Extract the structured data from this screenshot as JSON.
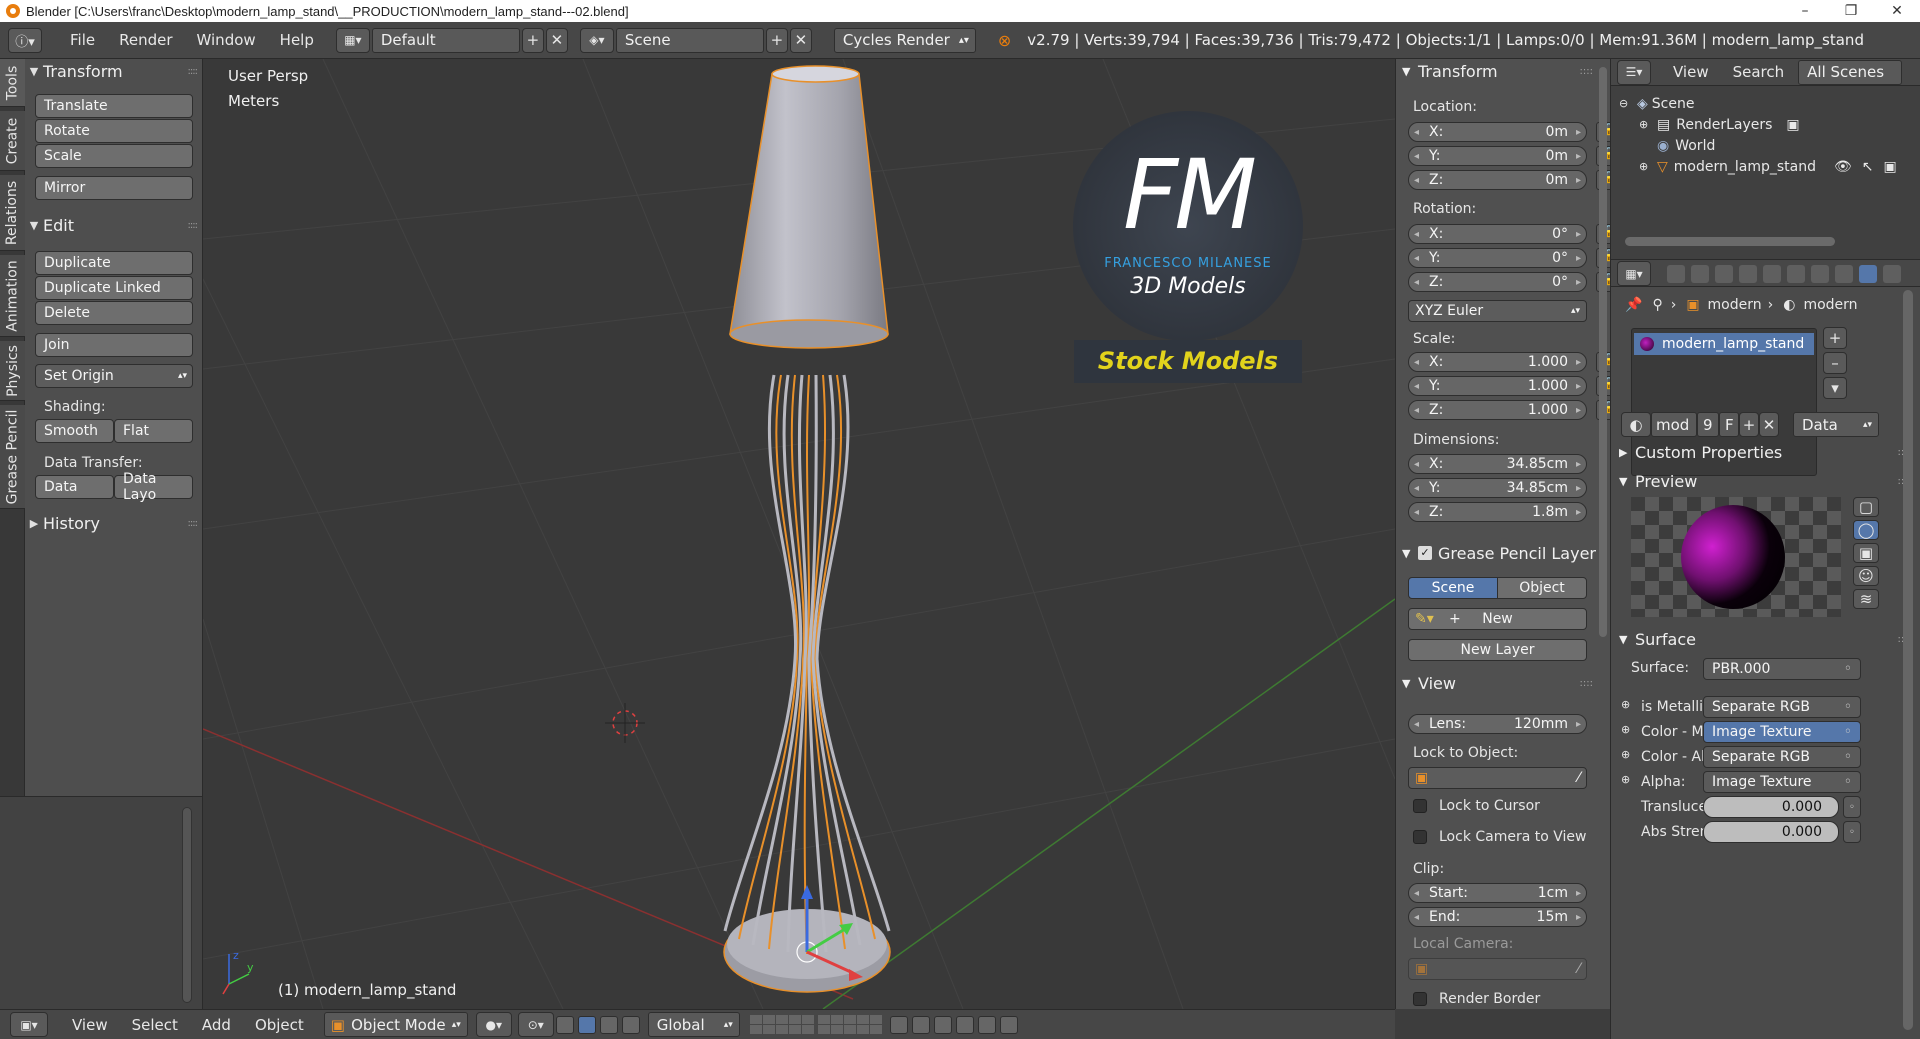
{
  "window": {
    "title": "Blender [C:\\Users\\franc\\Desktop\\modern_lamp_stand\\__PRODUCTION\\modern_lamp_stand---02.blend]",
    "minimize": "–",
    "maximize": "❐",
    "close": "✕"
  },
  "infobar": {
    "menus": [
      "File",
      "Render",
      "Window",
      "Help"
    ],
    "layout": "Default",
    "scene": "Scene",
    "engine": "Cycles Render",
    "stats": "v2.79 | Verts:39,794 | Faces:39,736 | Tris:79,472 | Objects:1/1 | Lamps:0/0 | Mem:91.36M | modern_lamp_stand"
  },
  "vtabs": [
    "Tools",
    "Create",
    "Relations",
    "Animation",
    "Physics",
    "Grease Pencil"
  ],
  "toolshelf": {
    "transform_title": "Transform",
    "translate": "Translate",
    "rotate": "Rotate",
    "scale": "Scale",
    "mirror": "Mirror",
    "edit_title": "Edit",
    "duplicate": "Duplicate",
    "duplicate_linked": "Duplicate Linked",
    "delete": "Delete",
    "join": "Join",
    "set_origin": "Set Origin",
    "shading_label": "Shading:",
    "smooth": "Smooth",
    "flat": "Flat",
    "data_transfer_label": "Data Transfer:",
    "data": "Data",
    "data_layout": "Data Layo",
    "history_title": "History"
  },
  "viewport": {
    "view_name": "User Persp",
    "units": "Meters",
    "object_label": "(1) modern_lamp_stand",
    "watermark": {
      "big": "FM",
      "name": "FRANCESCO MILANESE",
      "sub": "3D Models",
      "banner": "Stock Models"
    }
  },
  "npanel": {
    "transform_title": "Transform",
    "location_label": "Location:",
    "location": [
      {
        "k": "X:",
        "v": "0m"
      },
      {
        "k": "Y:",
        "v": "0m"
      },
      {
        "k": "Z:",
        "v": "0m"
      }
    ],
    "rotation_label": "Rotation:",
    "rotation": [
      {
        "k": "X:",
        "v": "0°"
      },
      {
        "k": "Y:",
        "v": "0°"
      },
      {
        "k": "Z:",
        "v": "0°"
      }
    ],
    "rotation_mode": "XYZ Euler",
    "scale_label": "Scale:",
    "scale": [
      {
        "k": "X:",
        "v": "1.000"
      },
      {
        "k": "Y:",
        "v": "1.000"
      },
      {
        "k": "Z:",
        "v": "1.000"
      }
    ],
    "dimensions_label": "Dimensions:",
    "dimensions": [
      {
        "k": "X:",
        "v": "34.85cm"
      },
      {
        "k": "Y:",
        "v": "34.85cm"
      },
      {
        "k": "Z:",
        "v": "1.8m"
      }
    ],
    "grease_title": "Grease Pencil Layer",
    "scene_tab": "Scene",
    "object_tab": "Object",
    "new_btn": "New",
    "new_layer_btn": "New Layer",
    "view_title": "View",
    "lens_label": "Lens:",
    "lens_value": "120mm",
    "lock_to_object": "Lock to Object:",
    "lock_to_cursor": "Lock to Cursor",
    "lock_camera": "Lock Camera to View",
    "clip_label": "Clip:",
    "clip_start_k": "Start:",
    "clip_start_v": "1cm",
    "clip_end_k": "End:",
    "clip_end_v": "15m",
    "local_camera": "Local Camera:",
    "render_border": "Render Border"
  },
  "outliner": {
    "view": "View",
    "search": "Search",
    "filter": "All Scenes",
    "items": [
      "Scene",
      "RenderLayers",
      "World",
      "modern_lamp_stand"
    ]
  },
  "properties": {
    "breadcrumb_1": "modern",
    "breadcrumb_2": "modern",
    "material_slot": "modern_lamp_stand",
    "mat_name": "mod",
    "mat_users": "9",
    "mat_fake": "F",
    "link_mode": "Data",
    "custom_props": "Custom Properties",
    "preview": "Preview",
    "surface_title": "Surface",
    "surface_label": "Surface:",
    "surface_value": "PBR.000",
    "inputs": [
      {
        "label": "is Metallic",
        "value": "Separate RGB"
      },
      {
        "label": "Color - Ma",
        "value": "Image Texture"
      },
      {
        "label": "Color - Ab",
        "value": "Separate RGB"
      },
      {
        "label": "Alpha:",
        "value": "Image Texture"
      }
    ],
    "translucent_label": "Transluce",
    "translucent_value": "0.000",
    "abs_label": "Abs Stren",
    "abs_value": "0.000"
  },
  "bottombar": {
    "view": "View",
    "select": "Select",
    "add": "Add",
    "object": "Object",
    "mode": "Object Mode",
    "orientation": "Global"
  },
  "colors": {
    "selection_outline": "#e8902a",
    "accent_blue": "#5577aa",
    "background": "#393939"
  }
}
